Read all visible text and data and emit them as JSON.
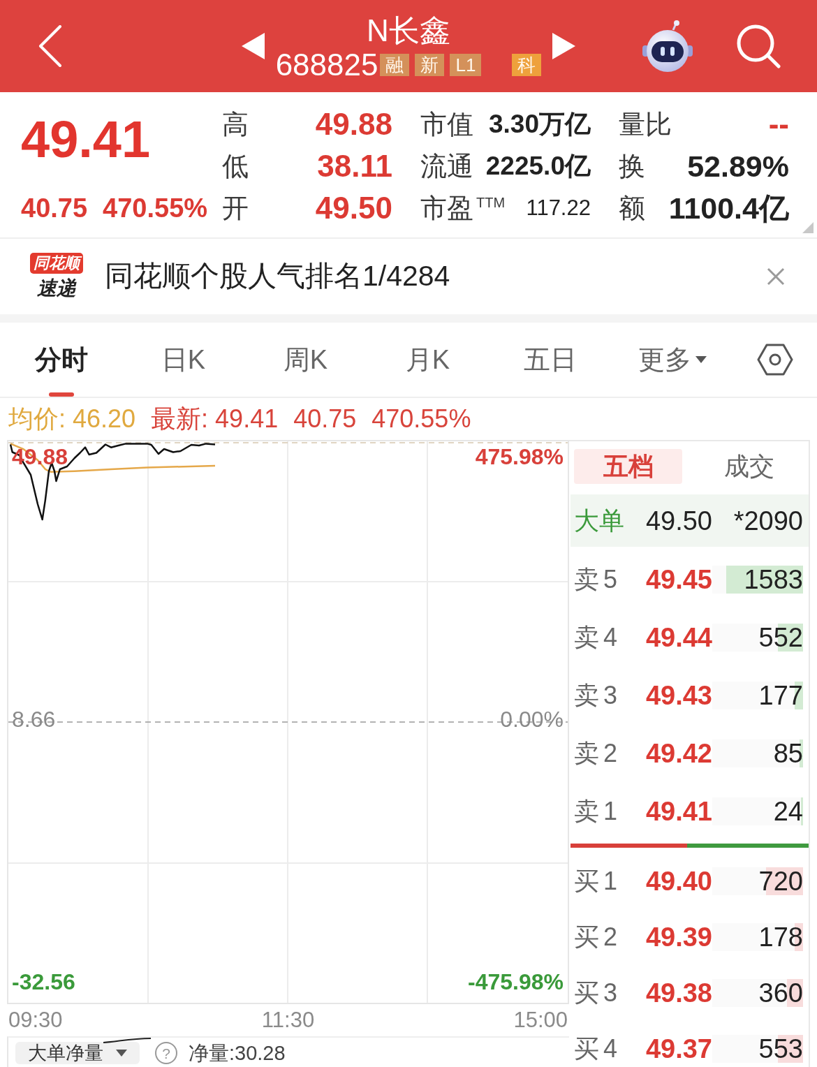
{
  "header": {
    "title": "N长鑫",
    "code": "688825",
    "tags": [
      {
        "label": "融",
        "color": "#d4915a"
      },
      {
        "label": "新",
        "color": "#d4915a"
      },
      {
        "label": "L1",
        "color": "#d4915a"
      },
      {
        "label": "科",
        "color": "#eea13c"
      }
    ]
  },
  "quote": {
    "price": "49.41",
    "change": "40.75",
    "change_pct": "470.55%",
    "columns": [
      [
        {
          "label": "高",
          "value": "49.88",
          "kind": "rise"
        },
        {
          "label": "低",
          "value": "38.11",
          "kind": "rise"
        },
        {
          "label": "开",
          "value": "49.50",
          "kind": "rise"
        }
      ],
      [
        {
          "label": "市值",
          "value": "3.30万亿",
          "kind": "value"
        },
        {
          "label": "流通",
          "value": "2225.0亿",
          "kind": "value"
        },
        {
          "label": "市盈$^{TTM}$",
          "value": "117.22",
          "kind": "small"
        }
      ],
      [
        {
          "label": "量比",
          "value": "--",
          "kind": "rise"
        },
        {
          "label": "换",
          "value": "52.89%",
          "kind": "large"
        },
        {
          "label": "额",
          "value": "1100.4亿",
          "kind": "large"
        }
      ]
    ]
  },
  "banner": {
    "logo_top": "同花顺",
    "logo_bottom": "速递",
    "text": "同花顺个股人气排名1/4284"
  },
  "tabs": [
    {
      "label": "分时",
      "selected": true,
      "kind": "tab"
    },
    {
      "label": "日K",
      "selected": false,
      "kind": "tab"
    },
    {
      "label": "周K",
      "selected": false,
      "kind": "tab"
    },
    {
      "label": "月K",
      "selected": false,
      "kind": "tab"
    },
    {
      "label": "五日",
      "selected": false,
      "kind": "tab"
    },
    {
      "label": "更多",
      "selected": false,
      "kind": "menu"
    }
  ],
  "legend": [
    {
      "text": "均价: 46.20",
      "color": "#e0a93f"
    },
    {
      "text": "最新: 49.41",
      "color": "#d8443b"
    },
    {
      "text": "40.75",
      "color": "#d8443b"
    },
    {
      "text": "470.55%",
      "color": "#d8443b"
    }
  ],
  "chart": {
    "left_labels": [
      {
        "text": "49.88",
        "kind": "up"
      },
      {
        "text": "8.66",
        "kind": "base"
      },
      {
        "text": "-32.56",
        "kind": "down"
      }
    ],
    "right_labels": [
      {
        "text": "475.98%",
        "kind": "up"
      },
      {
        "text": "0.00%",
        "kind": "base"
      },
      {
        "text": "-475.98%",
        "kind": "down"
      }
    ],
    "time_labels": [
      "09:30",
      "11:30",
      "15:00"
    ]
  },
  "lower_panel": {
    "selector": "大单净量",
    "help": "?",
    "value": "净量:30.28"
  },
  "order_book": {
    "tabs": [
      {
        "label": "五档",
        "selected": true
      },
      {
        "label": "成交",
        "selected": false
      }
    ],
    "big_order": {
      "label": "大单",
      "price": "49.50",
      "volume": "*2090"
    },
    "asks": [
      {
        "label": "卖5",
        "price": "49.45",
        "volume": "1583",
        "level": 0.85
      },
      {
        "label": "卖4",
        "price": "49.44",
        "volume": "552",
        "level": 0.28
      },
      {
        "label": "卖3",
        "price": "49.43",
        "volume": "177",
        "level": 0.09
      },
      {
        "label": "卖2",
        "price": "49.42",
        "volume": "85",
        "level": 0.04
      },
      {
        "label": "卖1",
        "price": "49.41",
        "volume": "24",
        "level": 0.02
      }
    ],
    "ratio_bar": {
      "level": 0.49
    },
    "bids": [
      {
        "label": "买1",
        "price": "49.40",
        "volume": "720",
        "level": 0.41
      },
      {
        "label": "买2",
        "price": "49.39",
        "volume": "178",
        "level": 0.09
      },
      {
        "label": "买3",
        "price": "49.38",
        "volume": "360",
        "level": 0.18
      },
      {
        "label": "买4",
        "price": "49.37",
        "volume": "553",
        "level": 0.28
      }
    ]
  }
}
